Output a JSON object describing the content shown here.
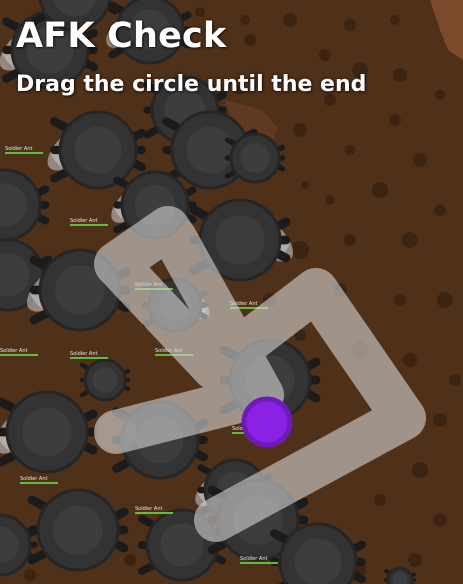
{
  "afk_check": {
    "title": "AFK Check",
    "subtitle": "Drag the circle until the end"
  },
  "mob_label": "Soldier Ant",
  "colors": {
    "dirt": "#4f3019",
    "dirt_hole": "#3c2413",
    "wall": "#7a4a2a",
    "ant_body": "#333333",
    "ant_center": "#3d3d3d",
    "ant_leg": "#1b1b1b",
    "wing": "#cfcfcf",
    "track": "#d0d0d0",
    "drag_handle": "#8a22e6",
    "drag_handle_ring": "#6f1ab8",
    "health_bar": "#5fbf3a"
  }
}
